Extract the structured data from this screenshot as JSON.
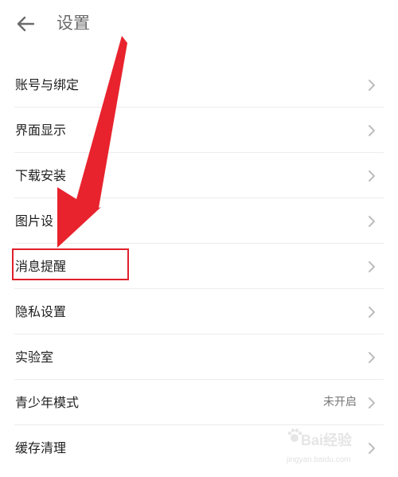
{
  "header": {
    "back_icon": "arrow-left-icon",
    "title": "设置"
  },
  "settings": {
    "items": [
      {
        "label": "账号与绑定",
        "value": ""
      },
      {
        "label": "界面显示",
        "value": ""
      },
      {
        "label": "下载安装",
        "value": ""
      },
      {
        "label": "图片设",
        "value": ""
      },
      {
        "label": "消息提醒",
        "value": ""
      },
      {
        "label": "隐私设置",
        "value": ""
      },
      {
        "label": "实验室",
        "value": ""
      },
      {
        "label": "青少年模式",
        "value": "未开启"
      },
      {
        "label": "缓存清理",
        "value": ""
      }
    ]
  },
  "annotation": {
    "highlight_color": "#e0202a",
    "arrow_color": "#e8232d"
  },
  "watermark": {
    "brand": "Bai经验",
    "url": "jingyan.baidu.com"
  }
}
